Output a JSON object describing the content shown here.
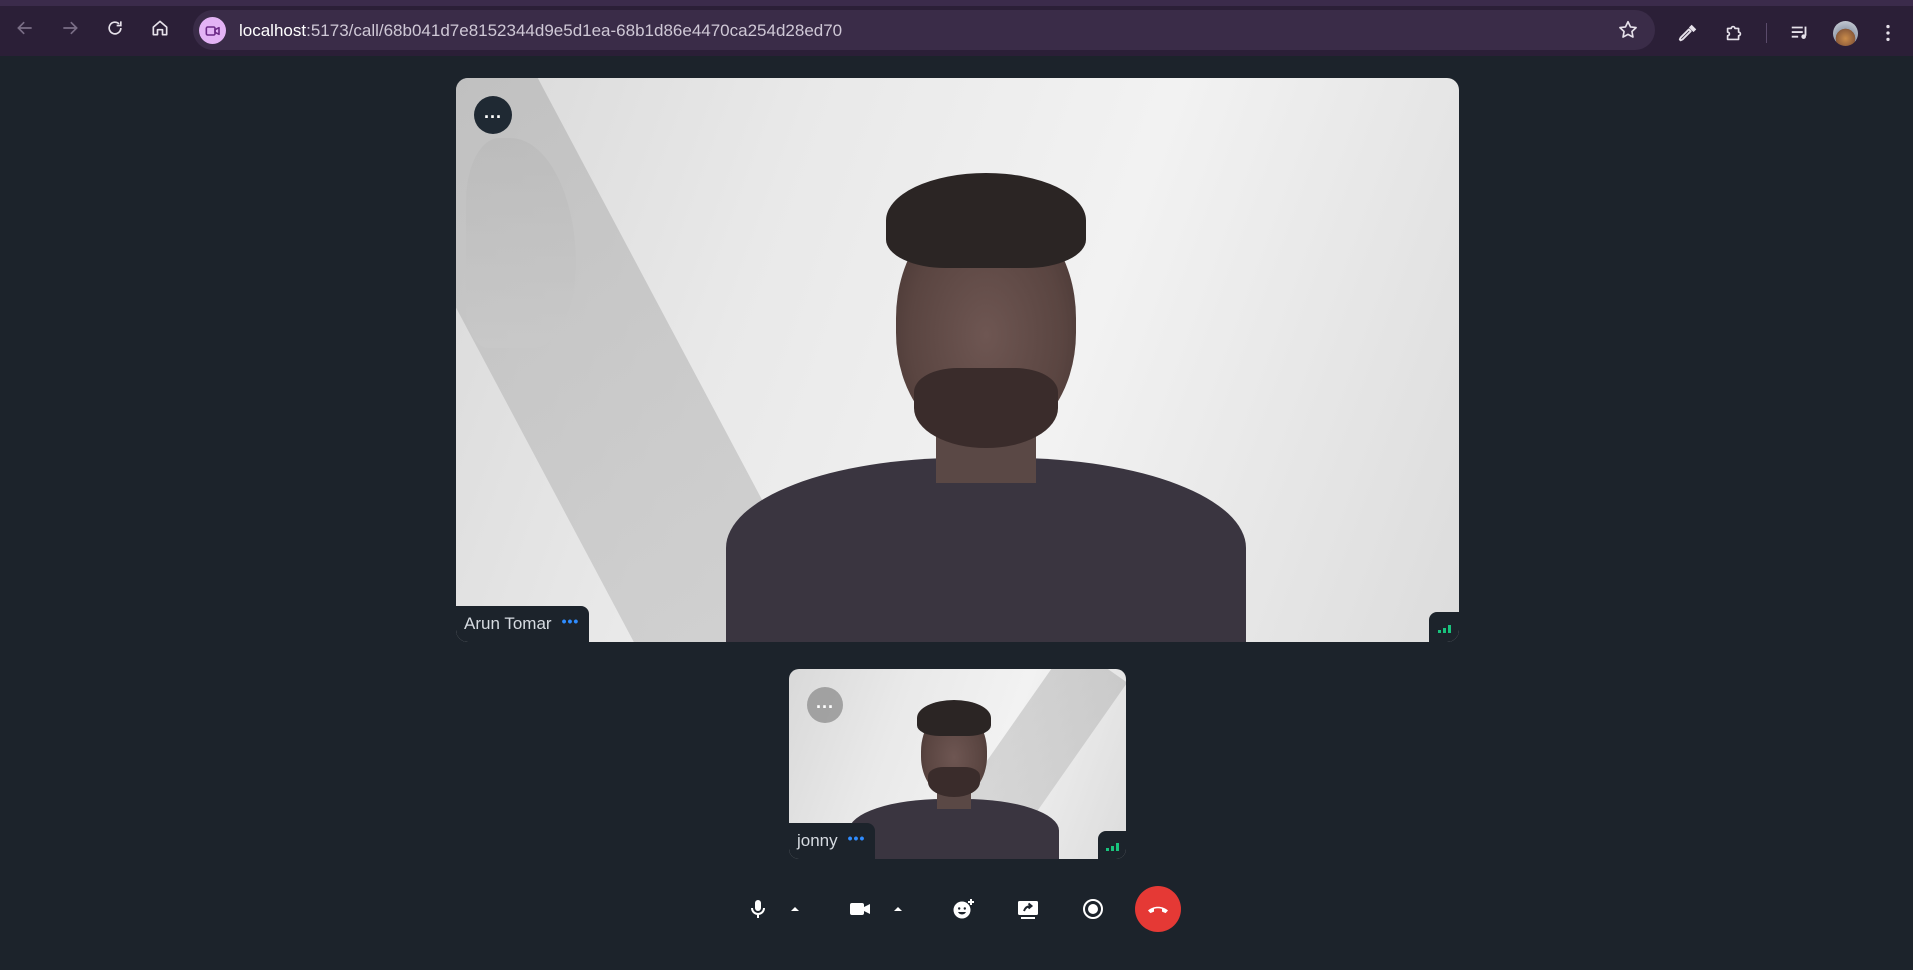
{
  "browser": {
    "url_host": "localhost",
    "url_path": ":5173/call/68b041d7e8152344d9e5d1ea-68b1d86e4470ca254d28ed70",
    "icons": [
      "back-arrow-icon",
      "forward-arrow-icon",
      "reload-icon",
      "home-icon",
      "video-camera-icon",
      "bookmark-star-icon",
      "eyedropper-icon",
      "extensions-puzzle-icon",
      "media-queue-icon",
      "profile-avatar",
      "kebab-menu-icon"
    ]
  },
  "call": {
    "main_participant": {
      "name": "Arun Tomar",
      "menu_icon": "more-dots-icon",
      "signal_icon": "network-signal-icon"
    },
    "self_participant": {
      "name": "jonny",
      "menu_icon": "more-dots-icon",
      "signal_icon": "network-signal-icon"
    }
  },
  "controls": {
    "items": [
      "microphone-icon",
      "audio-options-caret-icon",
      "camera-icon",
      "video-options-caret-icon",
      "reaction-emoji-icon",
      "screen-share-icon",
      "record-icon",
      "end-call-icon"
    ]
  },
  "colors": {
    "page_background": "#1c232b",
    "browser_frame": "#2b1f37",
    "omnibox": "#3a2c48",
    "accent_blue": "#2f8cff",
    "signal_green": "#19c37d",
    "hangup_red": "#e53935"
  }
}
